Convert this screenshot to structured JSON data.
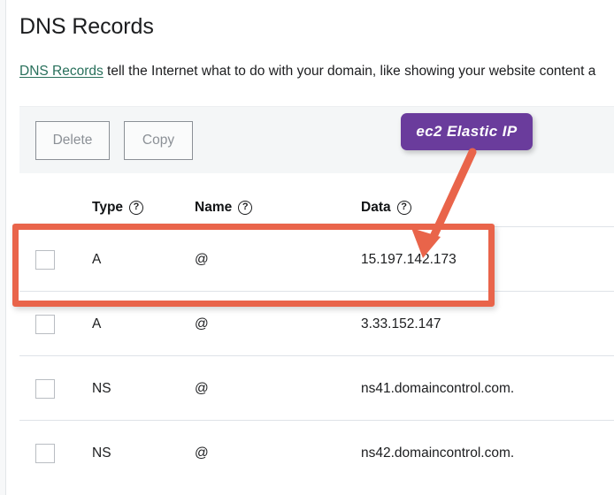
{
  "page": {
    "title": "DNS Records",
    "intro_link": "DNS Records",
    "intro_rest": " tell the Internet what to do with your domain, like showing your website content a"
  },
  "toolbar": {
    "delete_label": "Delete",
    "copy_label": "Copy"
  },
  "table": {
    "columns": [
      {
        "label": "Type",
        "help": "?"
      },
      {
        "label": "Name",
        "help": "?"
      },
      {
        "label": "Data",
        "help": "?"
      }
    ],
    "rows": [
      {
        "type": "A",
        "name": "@",
        "data": "15.197.142.173"
      },
      {
        "type": "A",
        "name": "@",
        "data": "3.33.152.147"
      },
      {
        "type": "NS",
        "name": "@",
        "data": "ns41.domaincontrol.com."
      },
      {
        "type": "NS",
        "name": "@",
        "data": "ns42.domaincontrol.com."
      }
    ]
  },
  "annotations": {
    "callout_label": "ec2 Elastic IP",
    "callout_color": "#6a3c9c",
    "highlight_color": "#e9644a",
    "arrow_color": "#e9644a",
    "highlighted_row_index": 0
  },
  "colors": {
    "link": "#28705b",
    "text": "#1c1d1f",
    "toolbar_bg": "#f4f6f7",
    "row_border": "#dfe3e8"
  }
}
